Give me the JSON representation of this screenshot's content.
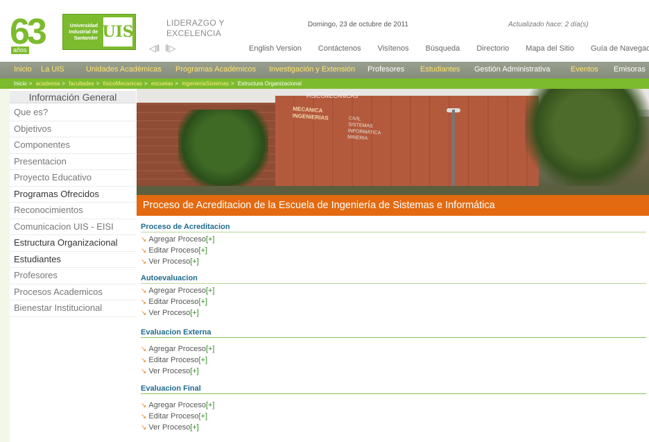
{
  "header": {
    "logo_number": "63",
    "logo_years": "años",
    "uis_text": [
      "Universidad",
      "Industrial de",
      "Santander"
    ],
    "uis_emblem": "UIS",
    "motto_line1": "LIDERAZGO Y",
    "motto_line2": "EXCELENCIA",
    "date": "Domingo, 23 de octubre de 2011",
    "updated": "Actualizado hace: 2 día(s)"
  },
  "top_links": [
    "English Version",
    "Contáctenos",
    "Visítenos",
    "Búsqueda",
    "Directorio",
    "Mapa del Sitio",
    "Guía de Navegació"
  ],
  "main_nav": [
    {
      "label": "Inicio",
      "highlight": true
    },
    {
      "label": "La UIS",
      "highlight": true
    },
    {
      "label": "Unidades Académicas",
      "highlight": true
    },
    {
      "label": "Programas Académicos",
      "highlight": true
    },
    {
      "label": "Investigación y Extensión",
      "highlight": true
    },
    {
      "label": "Profesores",
      "highlight": false
    },
    {
      "label": "Estudiantes",
      "highlight": true
    },
    {
      "label": "Gestión Administrativa",
      "highlight": false
    },
    {
      "label": "Eventos",
      "highlight": true
    },
    {
      "label": "Emisoras",
      "highlight": false
    }
  ],
  "breadcrumb": [
    {
      "label": "Inicio",
      "link": false
    },
    {
      "label": "academia",
      "link": true
    },
    {
      "label": "facultades",
      "link": true
    },
    {
      "label": "fisicoMecanicas",
      "link": true
    },
    {
      "label": "escuelas",
      "link": true
    },
    {
      "label": "ingenieriaSistemas",
      "link": true
    },
    {
      "label": "Estructura Organizacional",
      "link": false
    }
  ],
  "sidebar": {
    "title": "Información General",
    "items": [
      {
        "label": "Que es?",
        "dark": false
      },
      {
        "label": "Objetivos",
        "dark": false
      },
      {
        "label": "Componentes",
        "dark": false
      },
      {
        "label": "Presentacion",
        "dark": false
      },
      {
        "label": "Proyecto Educativo",
        "dark": false
      },
      {
        "label": "Programas Ofrecidos",
        "dark": true
      },
      {
        "label": "Reconocimientos",
        "dark": false
      },
      {
        "label": "Comunicacion UIS - EISI",
        "dark": false
      },
      {
        "label": "Estructura Organizacional",
        "dark": true
      },
      {
        "label": "Estudiantes",
        "dark": true
      },
      {
        "label": "Profesores",
        "dark": false
      },
      {
        "label": "Procesos Academicos",
        "dark": false
      },
      {
        "label": "Bienestar Institucional",
        "dark": false
      }
    ]
  },
  "banner": {
    "sign_top": "FISICOMECANICAS",
    "sign_main": [
      "MECANICA",
      "INGENIERIAS"
    ],
    "sign_sub": [
      "CIVIL",
      "SISTEMAS",
      "INFORMATICA",
      "MINERIA"
    ]
  },
  "page_title": "Proceso de Acreditacion de la Escuela de Ingeniería de Sistemas e Informática",
  "sections": [
    {
      "heading": "Proceso de Acreditacion",
      "links": [
        {
          "text": "Agregar Proceso",
          "plus": "[+]"
        },
        {
          "text": "Editar Proceso",
          "plus": "[+]"
        },
        {
          "text": "Ver Proceso",
          "plus": "[+]"
        }
      ]
    },
    {
      "heading": "Autoevaluacion",
      "links": [
        {
          "text": "Agregar Proceso",
          "plus": "[+]"
        },
        {
          "text": "Editar Proceso",
          "plus": "[+]"
        },
        {
          "text": "Ver Proceso",
          "plus": "[+]"
        }
      ]
    },
    {
      "heading": "Evaluacion Externa",
      "links": [
        {
          "text": "Agregar Proceso",
          "plus": "[+]"
        },
        {
          "text": "Editar Proceso",
          "plus": "[+]"
        },
        {
          "text": "Ver Proceso",
          "plus": "[+]"
        }
      ]
    },
    {
      "heading": "Evaluacion Final",
      "links": [
        {
          "text": "Agregar Proceso",
          "plus": "[+]"
        },
        {
          "text": "Editar Proceso",
          "plus": "[+]"
        },
        {
          "text": "Ver Proceso",
          "plus": "[+]"
        }
      ]
    }
  ],
  "colors": {
    "brand_green": "#7cbb2e",
    "orange": "#e36a10",
    "nav_gray": "#8f9584",
    "nav_highlight": "#ffe56a",
    "heading_blue": "#1f6b8e"
  }
}
